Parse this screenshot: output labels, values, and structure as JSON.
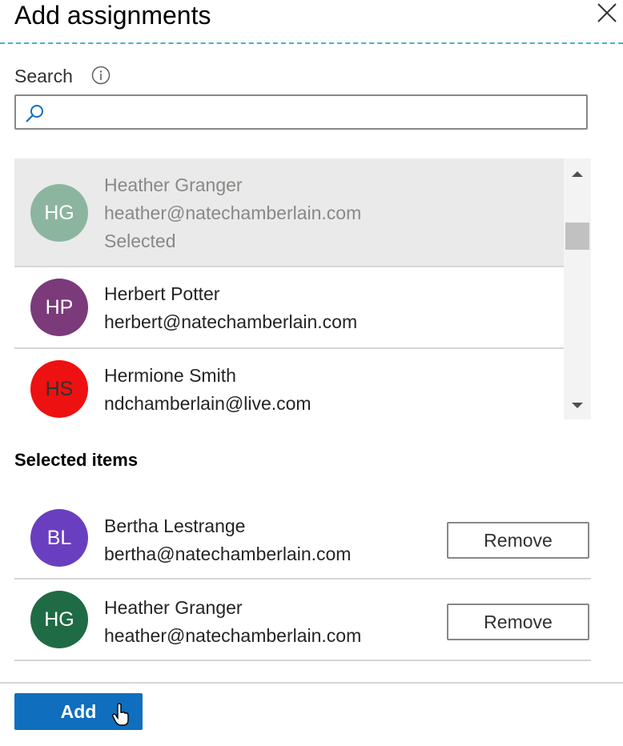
{
  "header": {
    "title": "Add assignments",
    "close_icon": "close-icon"
  },
  "search": {
    "label": "Search",
    "info_icon": "info-icon",
    "value": "",
    "placeholder": ""
  },
  "results": [
    {
      "initials": "HG",
      "name": "Heather Granger",
      "email": "heather@natechamberlain.com",
      "status": "Selected",
      "avatar_color": "#8cb5a0"
    },
    {
      "initials": "HP",
      "name": "Herbert Potter",
      "email": "herbert@natechamberlain.com",
      "avatar_color": "#7b3a7a"
    },
    {
      "initials": "HS",
      "name": "Hermione Smith",
      "email": "ndchamberlain@live.com",
      "avatar_color": "#ee1111"
    }
  ],
  "selected_section": {
    "title": "Selected items",
    "items": [
      {
        "initials": "BL",
        "name": "Bertha Lestrange",
        "email": "bertha@natechamberlain.com",
        "remove_label": "Remove",
        "avatar_color": "#6a3fbf"
      },
      {
        "initials": "HG",
        "name": "Heather Granger",
        "email": "heather@natechamberlain.com",
        "remove_label": "Remove",
        "avatar_color": "#1f6b45"
      }
    ]
  },
  "footer": {
    "add_label": "Add"
  },
  "colors": {
    "accent": "#106ebe",
    "divider": "#41b6c4"
  }
}
